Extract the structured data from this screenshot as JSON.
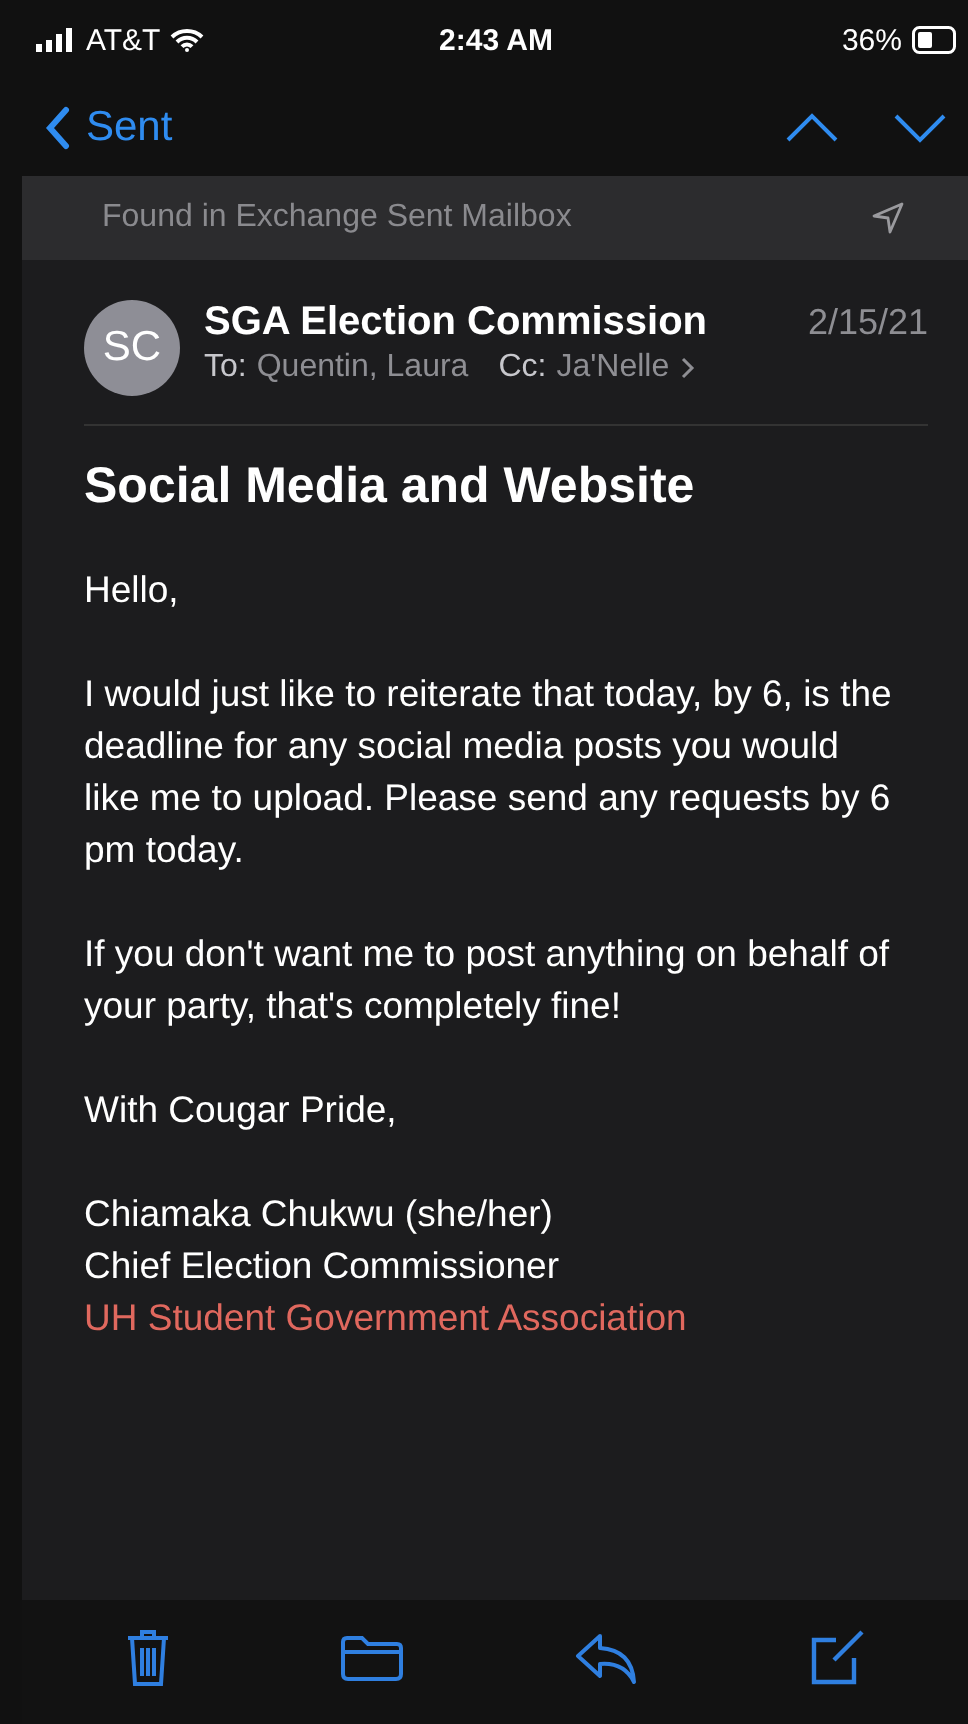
{
  "status_bar": {
    "carrier": "AT&T",
    "time": "2:43 AM",
    "battery": "36%"
  },
  "nav": {
    "back_label": "Sent"
  },
  "banner": {
    "text": "Found in Exchange Sent Mailbox"
  },
  "message": {
    "avatar": "SC",
    "sender": "SGA Election Commission",
    "date": "2/15/21",
    "to_label": "To:",
    "to": "Quentin, Laura",
    "cc_label": "Cc:",
    "cc": "Ja'Nelle",
    "subject": "Social Media and Website",
    "paragraphs": [
      {
        "kind": "text",
        "lines": [
          "Hello,"
        ]
      },
      {
        "kind": "text",
        "lines": [
          "I would just like to reiterate that today, by 6, is the deadline for any social media posts you would like me to upload. Please send any requests by 6 pm today."
        ]
      },
      {
        "kind": "text",
        "lines": [
          "If you don't want me to post anything on behalf of your party, that's completely fine!"
        ]
      },
      {
        "kind": "text",
        "lines": [
          "With Cougar Pride,"
        ]
      },
      {
        "kind": "signature",
        "lines": [
          "Chiamaka Chukwu (she/her)",
          "Chief Election Commissioner"
        ],
        "link": "UH Student Government Association"
      }
    ]
  }
}
